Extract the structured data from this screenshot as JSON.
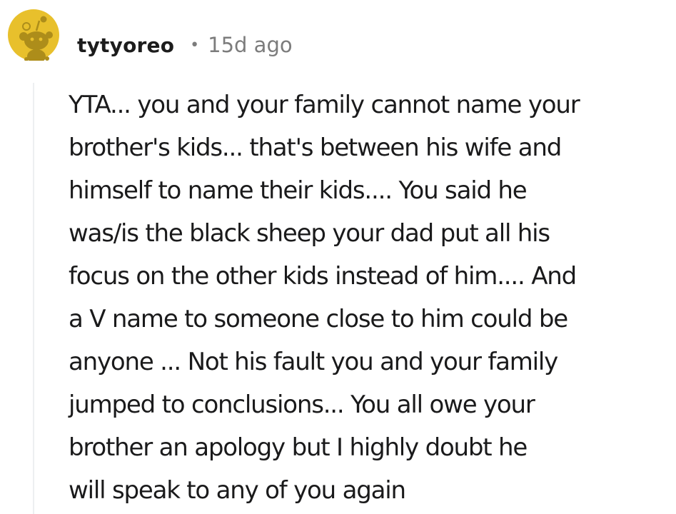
{
  "comment": {
    "author": "tytyoreo",
    "separator": "•",
    "timestamp": "15d ago",
    "avatar_icon": "snoo-avatar-icon",
    "avatar_color": "#e8c02c",
    "body_lines": [
      "YTA... you and your family cannot name your",
      "brother's kids... that's between his wife and",
      "himself to name their kids.... You said he",
      "was/is the black sheep your dad put all his",
      "focus on the other kids instead of him.... And",
      "a V name to someone close to him could be",
      "anyone ... Not his fault you and your family",
      "jumped to conclusions... You all owe your",
      "brother an apology but I highly doubt he",
      "will speak to any of you again"
    ]
  }
}
